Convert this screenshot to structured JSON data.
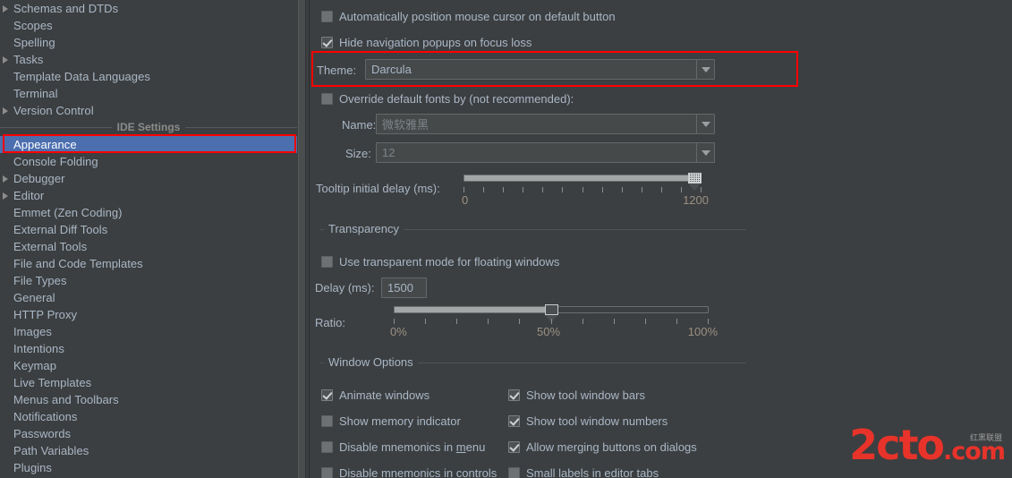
{
  "sidebar": {
    "items": [
      {
        "label": "Schemas and DTDs",
        "expandable": true,
        "selected": false
      },
      {
        "label": "Scopes",
        "expandable": false,
        "selected": false
      },
      {
        "label": "Spelling",
        "expandable": false,
        "selected": false
      },
      {
        "label": "Tasks",
        "expandable": true,
        "selected": false
      },
      {
        "label": "Template Data Languages",
        "expandable": false,
        "selected": false
      },
      {
        "label": "Terminal",
        "expandable": false,
        "selected": false
      },
      {
        "label": "Version Control",
        "expandable": true,
        "selected": false
      }
    ],
    "group_header": "IDE Settings",
    "ide_items": [
      {
        "label": "Appearance",
        "expandable": false,
        "selected": true
      },
      {
        "label": "Console Folding",
        "expandable": false,
        "selected": false
      },
      {
        "label": "Debugger",
        "expandable": true,
        "selected": false
      },
      {
        "label": "Editor",
        "expandable": true,
        "selected": false
      },
      {
        "label": "Emmet (Zen Coding)",
        "expandable": false,
        "selected": false
      },
      {
        "label": "External Diff Tools",
        "expandable": false,
        "selected": false
      },
      {
        "label": "External Tools",
        "expandable": false,
        "selected": false
      },
      {
        "label": "File and Code Templates",
        "expandable": false,
        "selected": false
      },
      {
        "label": "File Types",
        "expandable": false,
        "selected": false
      },
      {
        "label": "General",
        "expandable": false,
        "selected": false
      },
      {
        "label": "HTTP Proxy",
        "expandable": false,
        "selected": false
      },
      {
        "label": "Images",
        "expandable": false,
        "selected": false
      },
      {
        "label": "Intentions",
        "expandable": false,
        "selected": false
      },
      {
        "label": "Keymap",
        "expandable": false,
        "selected": false
      },
      {
        "label": "Live Templates",
        "expandable": false,
        "selected": false
      },
      {
        "label": "Menus and Toolbars",
        "expandable": false,
        "selected": false
      },
      {
        "label": "Notifications",
        "expandable": false,
        "selected": false
      },
      {
        "label": "Passwords",
        "expandable": false,
        "selected": false
      },
      {
        "label": "Path Variables",
        "expandable": false,
        "selected": false
      },
      {
        "label": "Plugins",
        "expandable": false,
        "selected": false
      }
    ]
  },
  "appearance": {
    "auto_position_cursor": {
      "label": "Automatically position mouse cursor on default button",
      "checked": false
    },
    "hide_nav_popups": {
      "label": "Hide navigation popups on focus loss",
      "checked": true
    },
    "theme_label": "Theme:",
    "theme_value": "Darcula",
    "override_fonts": {
      "label": "Override default fonts by (not recommended):",
      "checked": false
    },
    "font_name_label": "Name:",
    "font_name_value": "微软雅黑",
    "font_size_label": "Size:",
    "font_size_value": "12",
    "tooltip_delay_label": "Tooltip initial delay (ms):",
    "tooltip_delay_min": "0",
    "tooltip_delay_max": "1200",
    "tooltip_delay_value": 1200,
    "tooltip_ticks": 13
  },
  "transparency": {
    "title": "Transparency",
    "use_transparent": {
      "label": "Use transparent mode for floating windows",
      "checked": false
    },
    "delay_label": "Delay (ms):",
    "delay_value": "1500",
    "ratio_label": "Ratio:",
    "ratio_min": "0%",
    "ratio_mid": "50%",
    "ratio_max": "100%",
    "ratio_value": 50,
    "ratio_ticks": 11
  },
  "window_options": {
    "title": "Window Options",
    "left_column": [
      {
        "label": "Animate windows",
        "checked": true,
        "mnemonic": ""
      },
      {
        "label": "Show memory indicator",
        "checked": false,
        "mnemonic": ""
      },
      {
        "label": "Disable mnemonics in menu",
        "checked": false,
        "mnemonic": "m"
      },
      {
        "label": "Disable mnemonics in controls",
        "checked": false,
        "mnemonic": ""
      }
    ],
    "right_column": [
      {
        "label": "Show tool window bars",
        "checked": true
      },
      {
        "label": "Show tool window numbers",
        "checked": true
      },
      {
        "label": "Allow merging buttons on dialogs",
        "checked": true
      },
      {
        "label": "Small labels in editor tabs",
        "checked": false
      }
    ]
  },
  "watermark": {
    "text": "2cto",
    "domain": ".com",
    "cn": "红黑联盟"
  },
  "colors": {
    "background": "#3c3f41",
    "text": "#a9b7c6",
    "selection": "#4b6eaf",
    "highlight_red": "#ff0000",
    "tick_label": "#9a9083",
    "watermark_red": "#e8332a"
  }
}
